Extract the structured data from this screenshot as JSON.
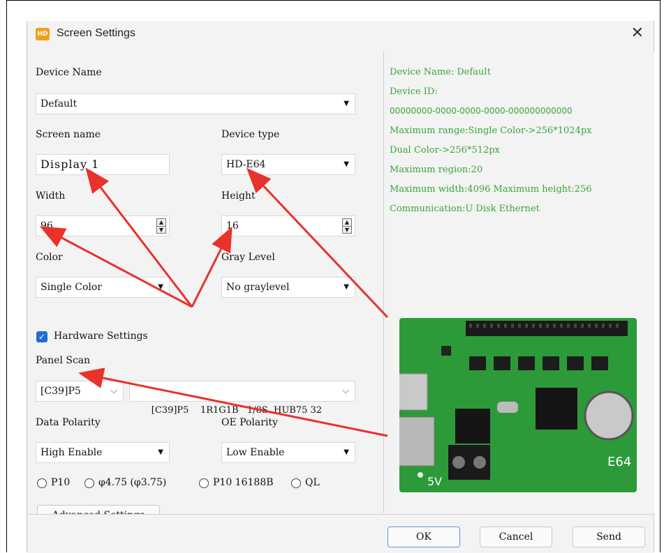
{
  "window": {
    "title": "Screen Settings",
    "close_symbol": "✕"
  },
  "form": {
    "device_name_label": "Device Name",
    "device_name_value": "Default",
    "screen_name_label": "Screen name",
    "screen_name_value": "Display 1",
    "device_type_label": "Device type",
    "device_type_value": "HD-E64",
    "width_label": "Width",
    "width_value": "96",
    "height_label": "Height",
    "height_value": "16",
    "color_label": "Color",
    "color_value": "Single Color",
    "gray_label": "Gray Level",
    "gray_value": "No graylevel",
    "hardware_label": "Hardware Settings",
    "hardware_checked": true,
    "panel_scan_label": "Panel Scan",
    "panel_scan_short": "[C39]P5",
    "panel_scan_full": "[C39]P5    1R1G1B   1/8S  HUB75 32",
    "data_polarity_label": "Data Polarity",
    "data_polarity_value": "High Enable",
    "oe_polarity_label": "OE Polarity",
    "oe_polarity_value": "Low Enable",
    "radios": [
      "P10",
      "φ4.75 (φ3.75)",
      "P10 16188B",
      "QL"
    ],
    "advanced_button": "Advanced Settings"
  },
  "info": {
    "lines": [
      "Device Name: Default",
      "Device ID:",
      "00000000-0000-0000-0000-000000000000",
      "Maximum range:Single Color->256*1024px",
      "Dual Color->256*512px",
      "Maximum region:20",
      "Maximum width:4096 Maximum height:256",
      "Communication:U Disk  Ethernet"
    ]
  },
  "board": {
    "silk_label": "E64",
    "power_label": "5V"
  },
  "buttons": {
    "ok": "OK",
    "cancel": "Cancel",
    "send": "Send"
  },
  "colors": {
    "info_text": "#3aa33a",
    "annotation_arrow": "#e8322a",
    "checkbox": "#1f6fd1",
    "pcb": "#2d9a3a"
  }
}
